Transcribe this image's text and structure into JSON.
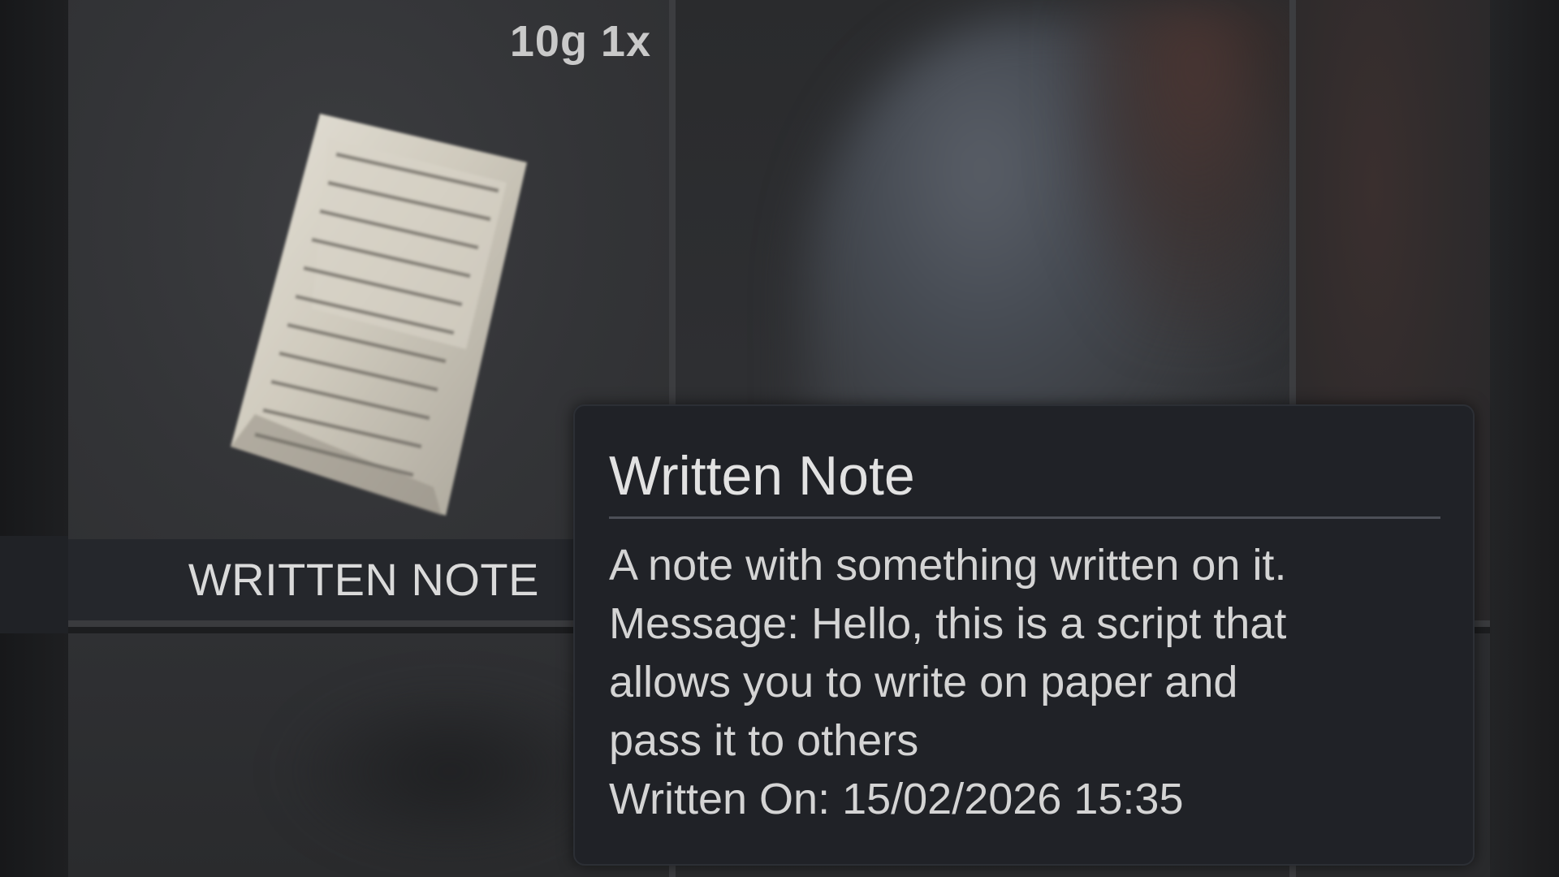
{
  "slot": {
    "weight_count": "10g 1x",
    "item_label": "WRITTEN NOTE",
    "item_icon": "paper-note-icon"
  },
  "tooltip": {
    "title": "Written Note",
    "description_lines": [
      "A note with something written on it.",
      "Message: Hello, this is a script that",
      "allows you to write on paper and",
      "pass it to others",
      "Written On: 15/02/2026 15:35"
    ]
  },
  "colors": {
    "tooltip_bg": "#202227",
    "slot_bg": "#333437",
    "label_bar_bg": "#25272c",
    "text": "#dadada"
  }
}
